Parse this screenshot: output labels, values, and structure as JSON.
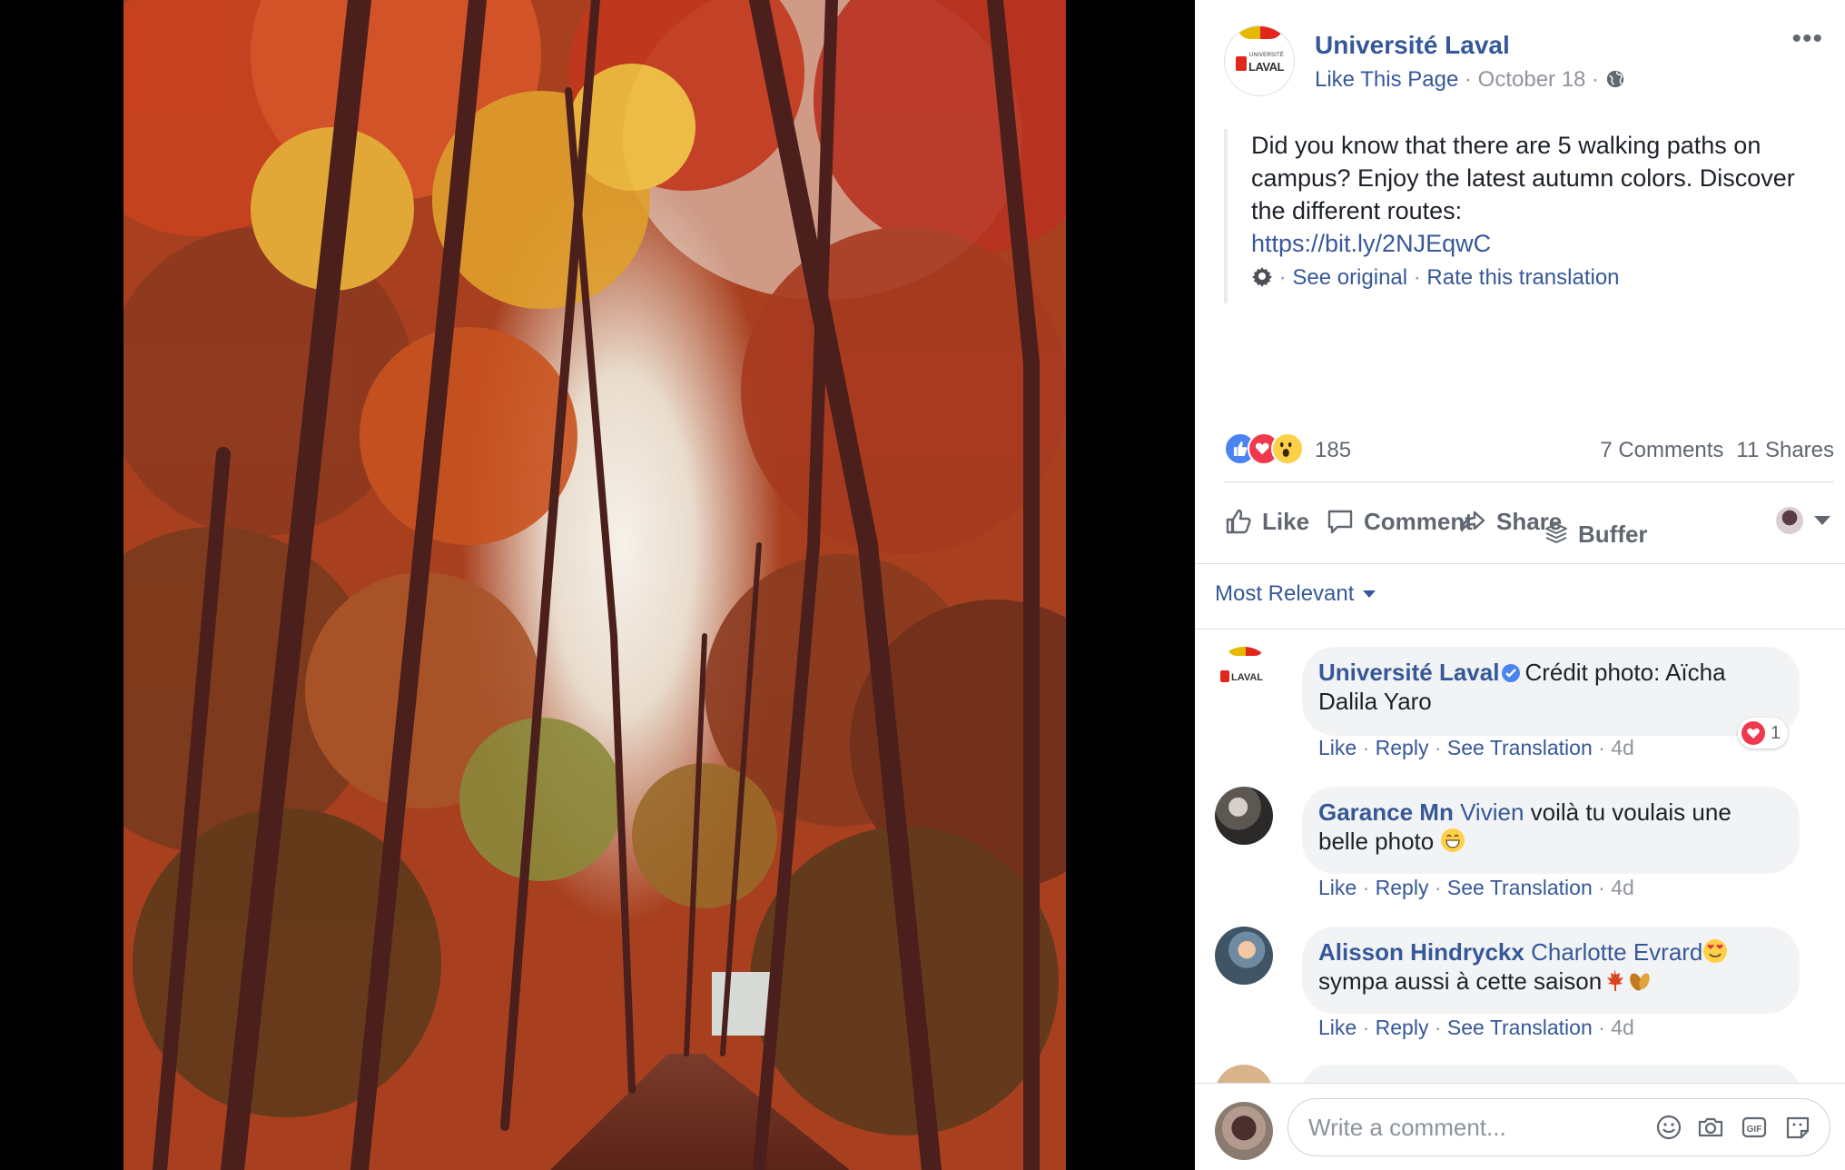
{
  "post": {
    "page_name": "Université Laval",
    "like_page": "Like This Page",
    "separator": " · ",
    "date": "October 18",
    "avatar_small_text": "UNIVERSITÉ",
    "avatar_wordmark": "LAVAL",
    "text": "Did you know that there are 5 walking paths on campus? Enjoy the latest autumn colors. Discover the different routes:",
    "link": "https://bit.ly/2NJEqwC",
    "see_original": "See original",
    "rate_translation": "Rate this translation"
  },
  "stats": {
    "reaction_count": "185",
    "comments": "7 Comments",
    "shares": "11 Shares"
  },
  "actions": {
    "like": "Like",
    "comment": "Comment",
    "share": "Share",
    "buffer": "Buffer"
  },
  "sort": {
    "label": "Most Relevant"
  },
  "comments": [
    {
      "author": "Université Laval",
      "text": "Crédit photo: Aïcha Dalila Yaro",
      "avatar_wordmark": "LAVAL",
      "like": "Like",
      "reply": "Reply",
      "see_translation": "See Translation",
      "age": "4d",
      "love_count": "1"
    },
    {
      "author": "Garance Mn",
      "tag": "Vivien",
      "text": " voilà tu voulais une belle photo ",
      "like": "Like",
      "reply": "Reply",
      "see_translation": "See Translation",
      "age": "4d"
    },
    {
      "author": "Alisson Hindryckx",
      "tag": "Charlotte Evrard",
      "text": "sympa aussi à cette saison",
      "like": "Like",
      "reply": "Reply",
      "see_translation": "See Translation",
      "age": "4d"
    }
  ],
  "composer": {
    "placeholder": "Write a comment..."
  },
  "colors": {
    "link": "#365899",
    "muted": "#90949c",
    "bubble": "#f2f3f5",
    "like_reaction": "#4a84f3",
    "love_reaction": "#f0394e",
    "wow_reaction": "#fcd148"
  },
  "icons": [
    "more-icon",
    "globe-icon",
    "gear-icon",
    "like-icon",
    "comment-icon",
    "share-icon",
    "buffer-icon",
    "verified-icon",
    "emoji-icon",
    "camera-icon",
    "gif-icon",
    "sticker-icon"
  ]
}
